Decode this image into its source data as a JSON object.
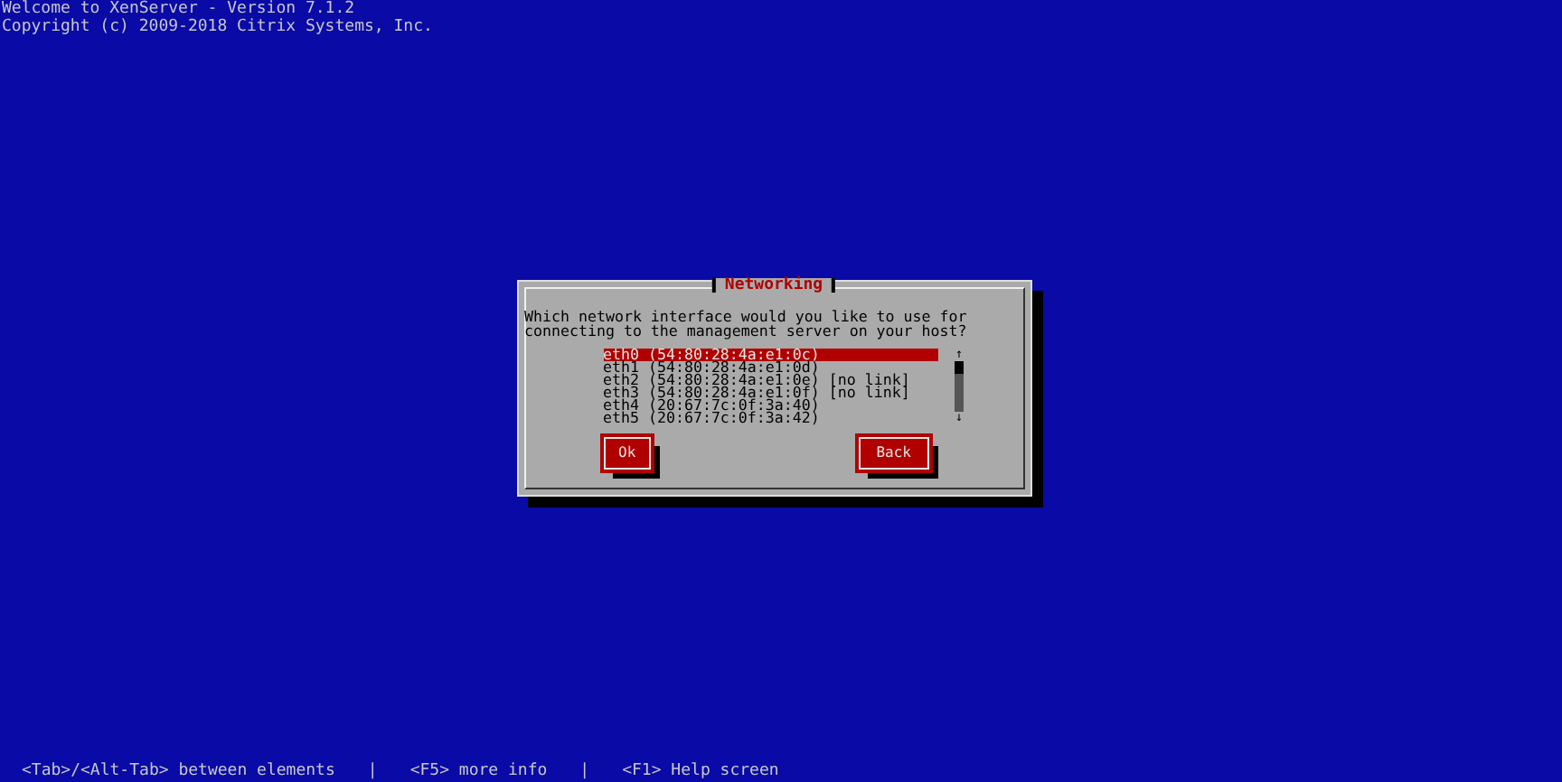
{
  "header": [
    "Welcome to XenServer - Version 7.1.2",
    "Copyright (c) 2009-2018 Citrix Systems, Inc."
  ],
  "dialog": {
    "title": "Networking",
    "question": "Which network interface would you like to use for connecting to the management server on your host?",
    "interfaces": [
      {
        "label": "eth0 (54:80:28:4a:e1:0c)",
        "selected": true
      },
      {
        "label": "eth1 (54:80:28:4a:e1:0d)",
        "selected": false
      },
      {
        "label": "eth2 (54:80:28:4a:e1:0e) [no link]",
        "selected": false
      },
      {
        "label": "eth3 (54:80:28:4a:e1:0f) [no link]",
        "selected": false
      },
      {
        "label": "eth4 (20:67:7c:0f:3a:40)",
        "selected": false
      },
      {
        "label": "eth5 (20:67:7c:0f:3a:42)",
        "selected": false
      }
    ],
    "scroll_up": "↑",
    "scroll_down": "↓",
    "buttons": [
      {
        "label": "Ok"
      },
      {
        "label": "Back"
      }
    ]
  },
  "status_bar": [
    "<Tab>/<Alt-Tab> between elements",
    "|",
    "<F5> more info",
    "|",
    "<F1> Help screen"
  ]
}
